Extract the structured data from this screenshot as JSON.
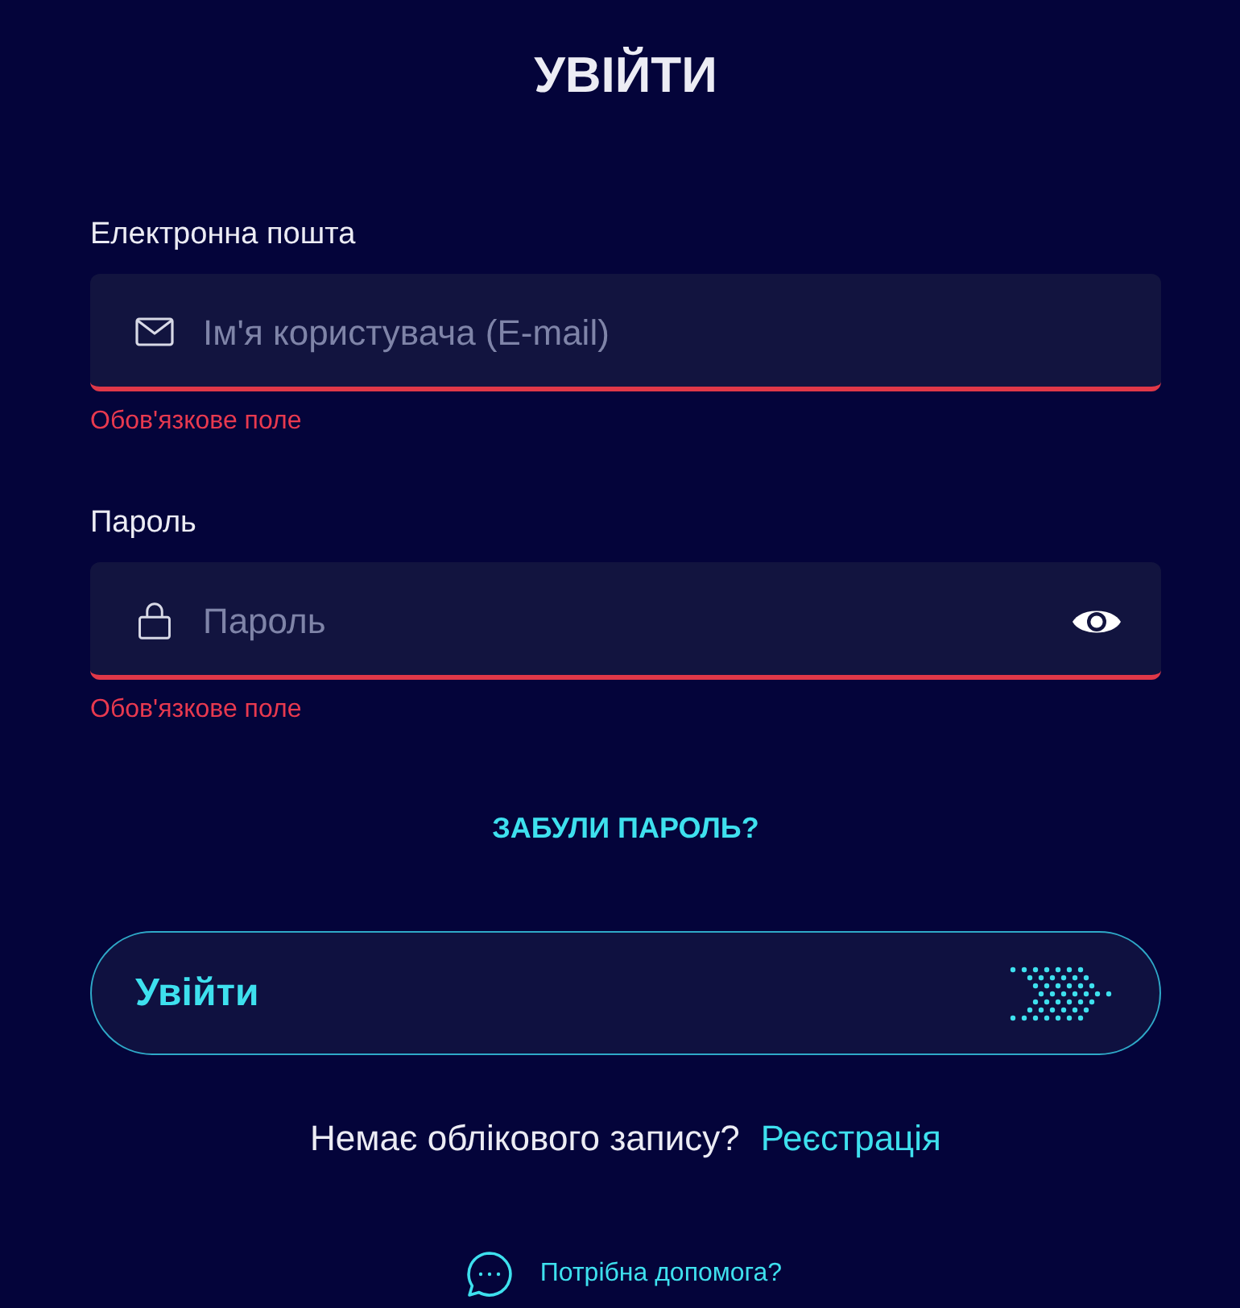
{
  "title": "УВІЙТИ",
  "fields": [
    {
      "kind": "email",
      "label": "Електронна пошта",
      "placeholder": "Ім'я користувача (E-mail)",
      "invalid": true,
      "error": "Обов'язкове поле"
    },
    {
      "kind": "password",
      "label": "Пароль",
      "placeholder": "Пароль",
      "invalid": true,
      "error": "Обов'язкове поле"
    }
  ],
  "forgot_link": "ЗАБУЛИ ПАРОЛЬ?",
  "submit_button": "Увійти",
  "signup": {
    "text": "Немає облікового запису?",
    "link": "Реєстрація"
  },
  "help_link": "Потрібна допомога?"
}
